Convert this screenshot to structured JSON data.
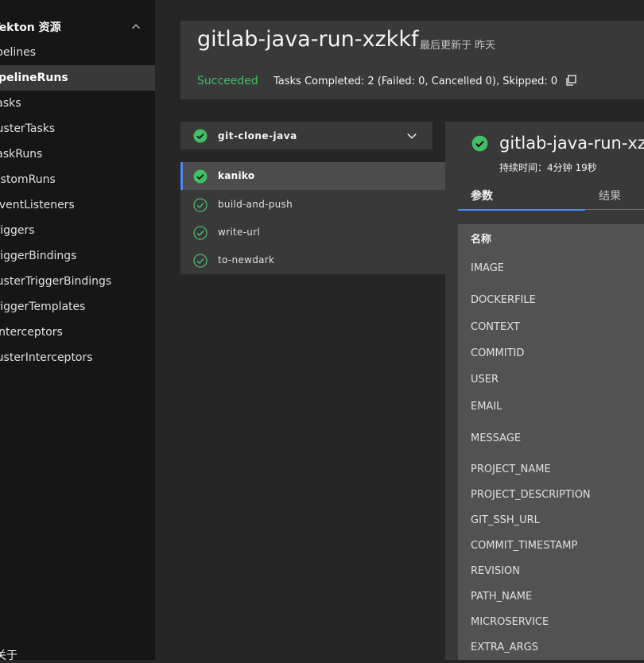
{
  "sidebar": {
    "section_title": "Tekton 资源",
    "items": [
      {
        "label": "Pipelines"
      },
      {
        "label": "PipelineRuns"
      },
      {
        "label": "Tasks"
      },
      {
        "label": "ClusterTasks"
      },
      {
        "label": "TaskRuns"
      },
      {
        "label": "CustomRuns"
      },
      {
        "label": "EventListeners"
      },
      {
        "label": "Triggers"
      },
      {
        "label": "TriggerBindings"
      },
      {
        "label": "ClusterTriggerBindings"
      },
      {
        "label": "TriggerTemplates"
      },
      {
        "label": "Interceptors"
      },
      {
        "label": "ClusterInterceptors"
      }
    ],
    "active_item": "PipelineRuns",
    "footer": "关于"
  },
  "header": {
    "run_name": "gitlab-java-run-xzkkf",
    "last_updated": "最后更新于 昨天",
    "status": "Succeeded",
    "summary": "Tasks Completed: 2 (Failed: 0, Cancelled 0), Skipped: 0"
  },
  "task_tree": {
    "group": {
      "name": "git-clone-java",
      "status": "succeeded"
    },
    "steps": [
      {
        "name": "kaniko",
        "status": "succeeded",
        "selected": true
      },
      {
        "name": "build-and-push",
        "status": "succeeded"
      },
      {
        "name": "write-url",
        "status": "succeeded"
      },
      {
        "name": "to-newdark",
        "status": "succeeded"
      }
    ]
  },
  "detail": {
    "title": "gitlab-java-run-xzkkf",
    "duration": "持续时间：4分钟 19秒",
    "tabs": [
      {
        "label": "参数",
        "selected": true
      },
      {
        "label": "结果",
        "selected": false
      }
    ],
    "params_table": {
      "header_name": "名称",
      "rows": [
        "IMAGE",
        "DOCKERFILE",
        "CONTEXT",
        "COMMITID",
        "USER",
        "EMAIL",
        "MESSAGE",
        "PROJECT_NAME",
        "PROJECT_DESCRIPTION",
        "GIT_SSH_URL",
        "COMMIT_TIMESTAMP",
        "REVISION",
        "PATH_NAME",
        "MICROSERVICE",
        "EXTRA_ARGS"
      ]
    }
  },
  "colors": {
    "success": "#42be65",
    "accent": "#4589ff",
    "sidebar_bg": "#161616",
    "page_bg": "#262626",
    "panel_bg": "#393939"
  }
}
